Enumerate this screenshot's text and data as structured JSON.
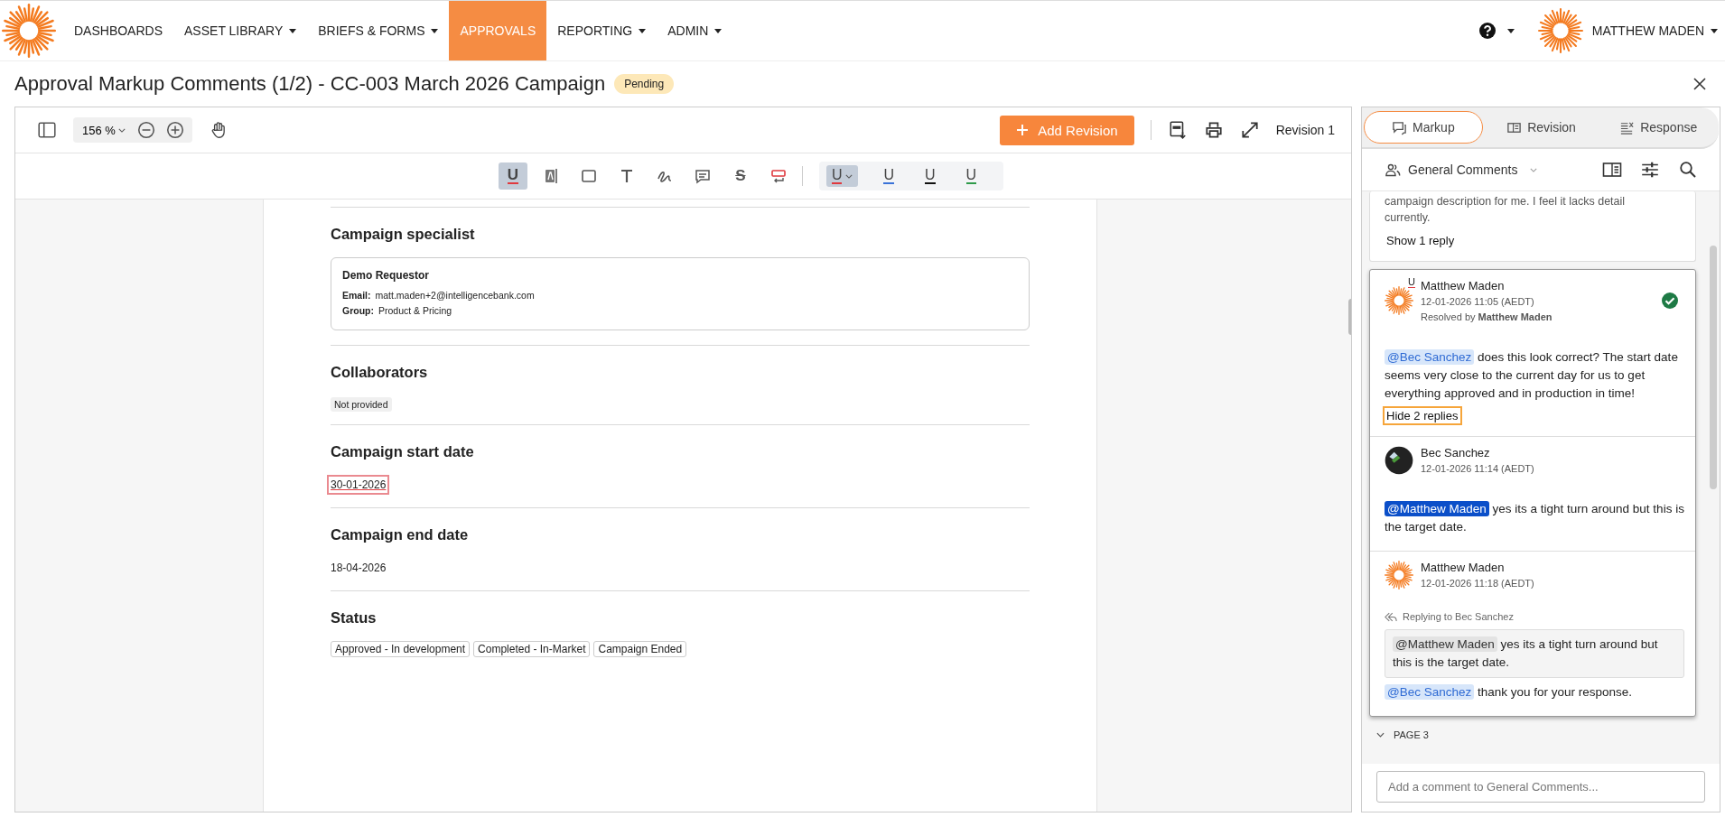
{
  "nav": {
    "items": [
      {
        "label": "DASHBOARDS",
        "selected": false,
        "menu": false
      },
      {
        "label": "ASSET LIBRARY",
        "selected": false,
        "menu": true
      },
      {
        "label": "BRIEFS & FORMS",
        "selected": false,
        "menu": true
      },
      {
        "label": "APPROVALS",
        "selected": true,
        "menu": false
      },
      {
        "label": "REPORTING",
        "selected": false,
        "menu": true
      },
      {
        "label": "ADMIN",
        "selected": false,
        "menu": true
      }
    ],
    "user": "MATTHEW MADEN"
  },
  "header": {
    "title": "Approval Markup Comments (1/2) - CC-003 March 2026 Campaign",
    "status": "Pending"
  },
  "viewer": {
    "zoom": "156 %",
    "add_button": "Add Revision",
    "revision": "Revision 1",
    "tools": [
      {
        "kind": "underline",
        "glyph": "U",
        "selected": true
      },
      {
        "kind": "highlight",
        "selected": false
      },
      {
        "kind": "rectangle",
        "selected": false
      },
      {
        "kind": "text",
        "selected": false
      },
      {
        "kind": "freehand",
        "selected": false
      },
      {
        "kind": "comment",
        "selected": false
      },
      {
        "kind": "strike",
        "glyph": "S",
        "selected": false
      },
      {
        "kind": "replace",
        "selected": false
      }
    ],
    "colors": [
      {
        "glyph": "U",
        "color": "#e0393e",
        "selected": true
      },
      {
        "glyph": "U",
        "color": "#3a72d8",
        "selected": false
      },
      {
        "glyph": "U",
        "color": "#111111",
        "selected": false
      },
      {
        "glyph": "U",
        "color": "#2e9a4a",
        "selected": false
      }
    ]
  },
  "document": {
    "sections": [
      {
        "kind": "card",
        "heading": "Campaign specialist",
        "name": "Demo Requestor",
        "fields": [
          {
            "label": "Email:",
            "value": "matt.maden+2@intelligencebank.com"
          },
          {
            "label": "Group:",
            "value": "Product & Pricing"
          }
        ]
      },
      {
        "kind": "note",
        "heading": "Collaborators",
        "text": "Not provided"
      },
      {
        "kind": "value",
        "heading": "Campaign start date",
        "value": "30-01-2026",
        "marked": true
      },
      {
        "kind": "value",
        "heading": "Campaign end date",
        "value": "18-04-2026",
        "marked": false
      },
      {
        "kind": "tags",
        "heading": "Status",
        "tags": [
          "Approved - In development",
          "Completed - In-Market",
          "Campaign Ended"
        ]
      }
    ]
  },
  "panel": {
    "tabs": [
      {
        "label": "Markup",
        "selected": true
      },
      {
        "label": "Revision",
        "selected": false
      },
      {
        "label": "Response",
        "selected": false
      }
    ],
    "filter": "General Comments",
    "earlier": {
      "text": "campaign description for me. I feel it lacks detail currently.",
      "toggle": "Show 1 reply"
    },
    "thread": {
      "author": "Matthew Maden",
      "time": "12-01-2026 11:05 (AEDT)",
      "markup_glyph": "U",
      "resolved": true,
      "resolved_by": "Resolved by **Matthew Maden**",
      "mention": "@Bec Sanchez",
      "text": "does this look correct? The start date seems very close to the current day for us to get everything approved and in production in time!",
      "toggle": "Hide 2 replies",
      "toggle_focused": true,
      "replies": [
        {
          "author": "Bec Sanchez",
          "kind": "photo",
          "time": "12-01-2026 11:14 (AEDT)",
          "mention": "@Matthew Maden",
          "mention_selected": true,
          "text": "yes its a tight turn around but this is the target date."
        },
        {
          "author": "Matthew Maden",
          "kind": "logo",
          "time": "12-01-2026 11:18 (AEDT)",
          "replying_to": "Replying to Bec Sanchez",
          "quote": {
            "mention": "@Matthew Maden",
            "text": "yes its a tight turn around but this is the target date."
          },
          "mention": "@Bec Sanchez",
          "mention_selected": false,
          "text": "thank you for your response."
        }
      ]
    },
    "page_group": {
      "label": "PAGE 3",
      "expanded": true
    },
    "composer": {
      "placeholder": "Add a comment to General Comments..."
    }
  }
}
